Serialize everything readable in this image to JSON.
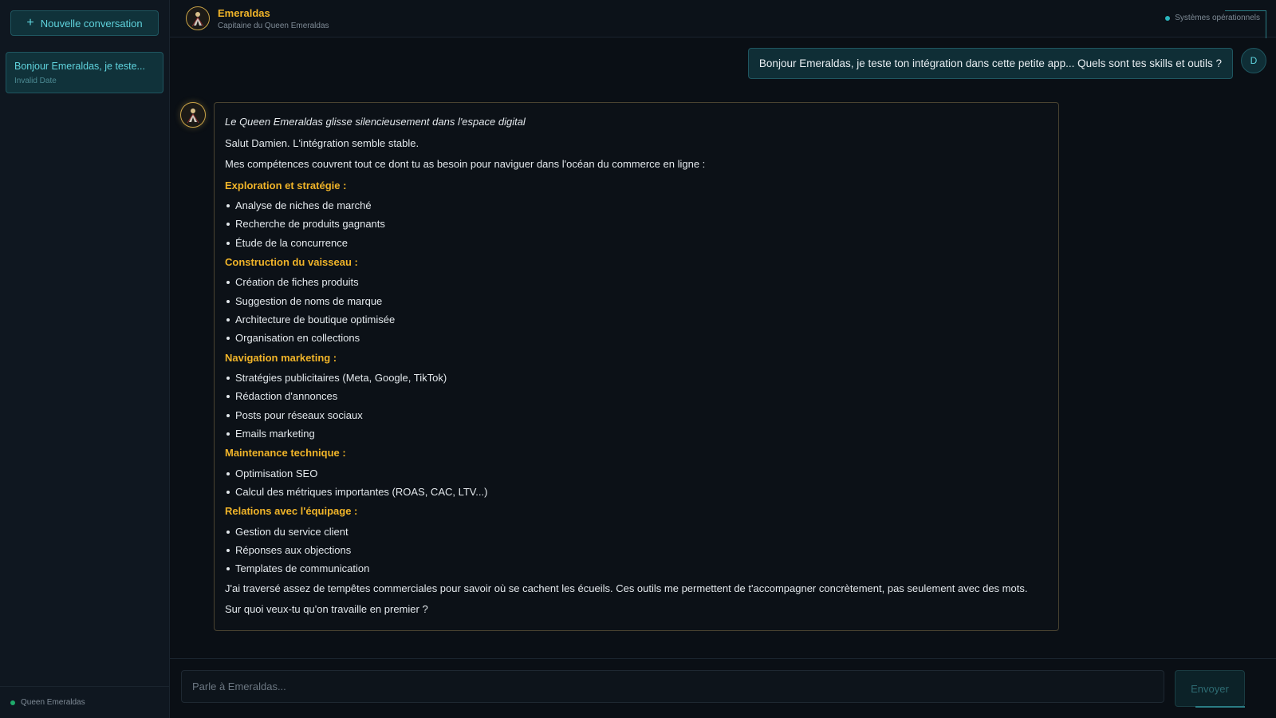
{
  "sidebar": {
    "new_conversation_label": "Nouvelle conversation",
    "conversations": [
      {
        "title": "Bonjour Emeraldas, je teste...",
        "date": "Invalid Date"
      }
    ],
    "footer_label": "Queen Emeraldas"
  },
  "header": {
    "agent_name": "Emeraldas",
    "agent_role": "Capitaine du Queen Emeraldas",
    "status_text": "Systèmes opérationnels"
  },
  "messages": {
    "user": {
      "avatar_initial": "D",
      "text": "Bonjour Emeraldas, je teste ton intégration dans cette petite app... Quels sont tes skills et outils ?"
    },
    "bot": {
      "intro_italic": "Le Queen Emeraldas glisse silencieusement dans l'espace digital",
      "greeting": "Salut Damien. L'intégration semble stable.",
      "lead": "Mes compétences couvrent tout ce dont tu as besoin pour naviguer dans l'océan du commerce en ligne :",
      "sections": [
        {
          "title": "Exploration et stratégie :",
          "items": [
            "Analyse de niches de marché",
            "Recherche de produits gagnants",
            "Étude de la concurrence"
          ]
        },
        {
          "title": "Construction du vaisseau :",
          "items": [
            "Création de fiches produits",
            "Suggestion de noms de marque",
            "Architecture de boutique optimisée",
            "Organisation en collections"
          ]
        },
        {
          "title": "Navigation marketing :",
          "items": [
            "Stratégies publicitaires (Meta, Google, TikTok)",
            "Rédaction d'annonces",
            "Posts pour réseaux sociaux",
            "Emails marketing"
          ]
        },
        {
          "title": "Maintenance technique :",
          "items": [
            "Optimisation SEO",
            "Calcul des métriques importantes (ROAS, CAC, LTV...)"
          ]
        },
        {
          "title": "Relations avec l'équipage :",
          "items": [
            "Gestion du service client",
            "Réponses aux objections",
            "Templates de communication"
          ]
        }
      ],
      "closing": "J'ai traversé assez de tempêtes commerciales pour savoir où se cachent les écueils. Ces outils me permettent de t'accompagner concrètement, pas seulement avec des mots.",
      "question": "Sur quoi veux-tu qu'on travaille en premier ?"
    }
  },
  "composer": {
    "placeholder": "Parle à Emeraldas...",
    "send_label": "Envoyer"
  },
  "colors": {
    "accent_teal": "#5fd3dd",
    "accent_gold": "#f0b429",
    "status_green": "#1faa6b",
    "background": "#0a0f15"
  }
}
